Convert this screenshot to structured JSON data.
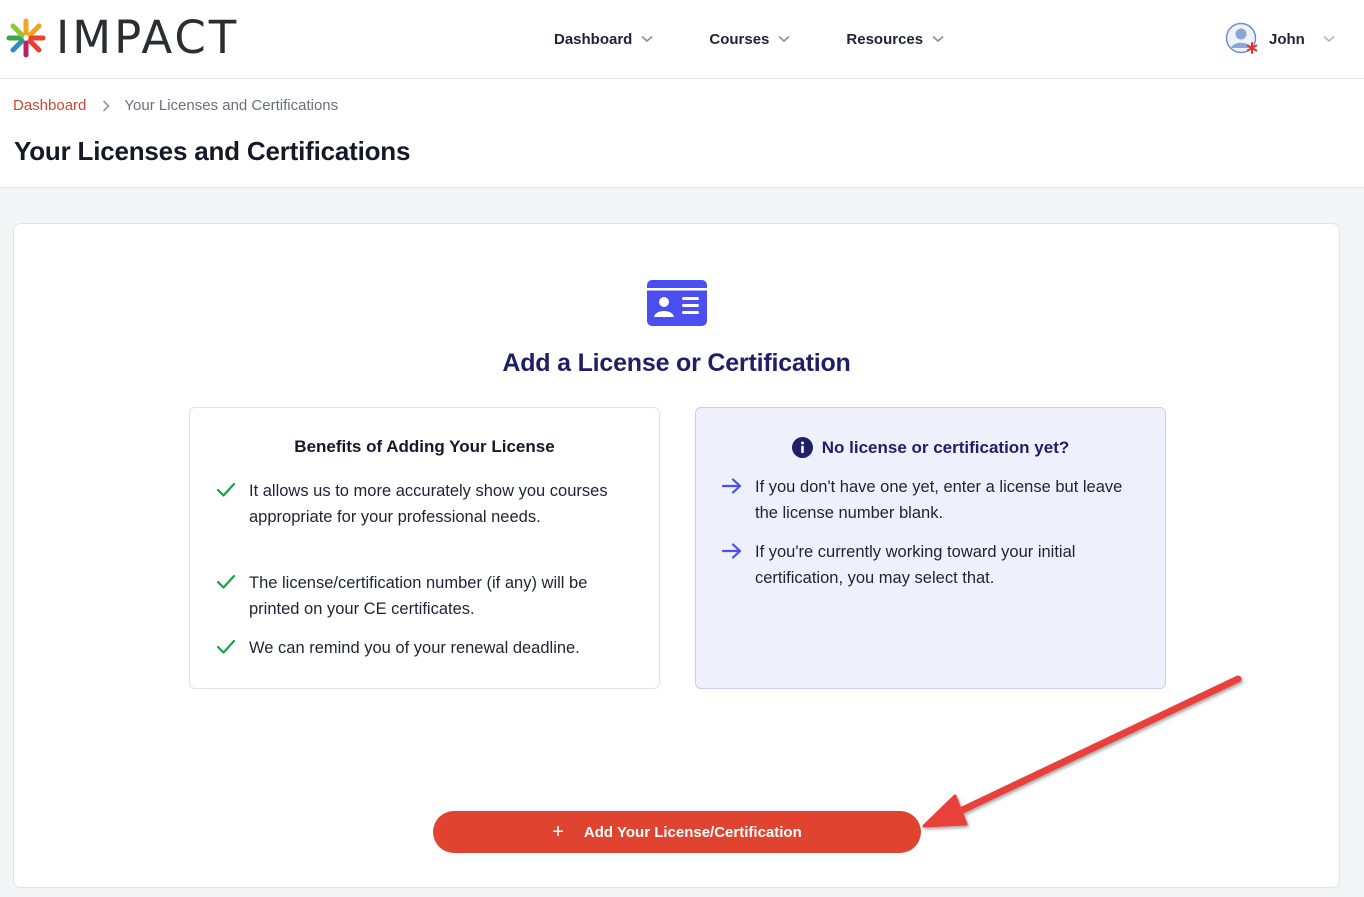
{
  "header": {
    "logo_text": "IMPACT",
    "nav": [
      {
        "label": "Dashboard"
      },
      {
        "label": "Courses"
      },
      {
        "label": "Resources"
      }
    ],
    "user": {
      "name": "John"
    }
  },
  "breadcrumb": {
    "home": "Dashboard",
    "current": "Your Licenses and Certifications"
  },
  "page": {
    "title": "Your Licenses and Certifications"
  },
  "card": {
    "title": "Add a License or Certification",
    "benefits": {
      "title": "Benefits of Adding Your License",
      "items": [
        "It allows us to more accurately show you courses appropriate for your professional needs.",
        "The license/certification number (if any) will be printed on your CE certificates.",
        "We can remind you of your renewal deadline."
      ]
    },
    "no_license": {
      "title": "No license or certification yet?",
      "items": [
        "If you don't have one yet, enter a license but leave the license number blank.",
        "If you're currently working toward your initial certification, you may select that."
      ]
    },
    "add_button": {
      "icon": "+",
      "label": "Add Your License/Certification"
    }
  },
  "colors": {
    "accent_red": "#e04430",
    "brand_indigo": "#4b4ef0",
    "title_navy": "#1e1f66",
    "check_green": "#16a34a"
  }
}
